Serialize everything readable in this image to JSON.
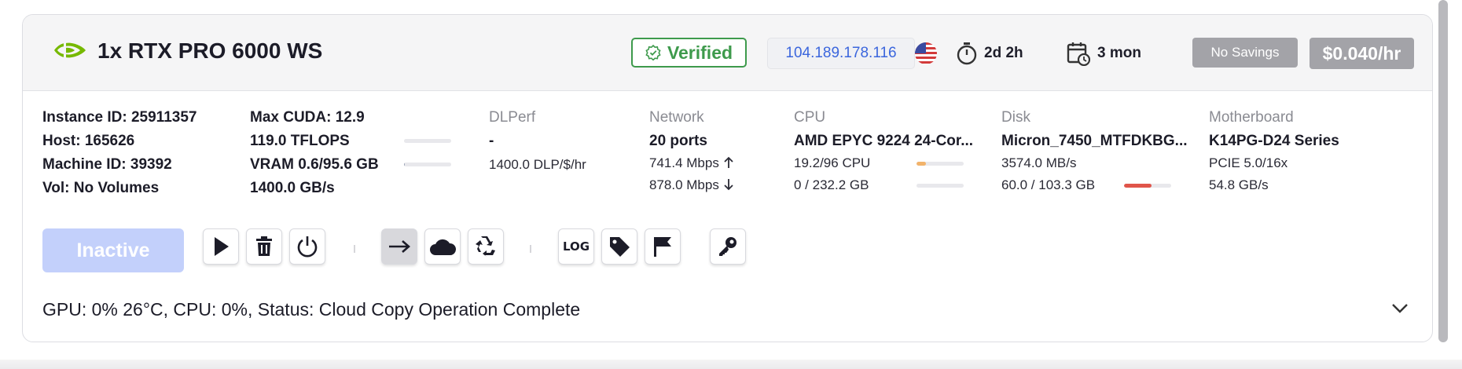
{
  "header": {
    "gpu_title": "1x RTX PRO 6000 WS",
    "verified_label": "Verified",
    "ip_address": "104.189.178.116",
    "uptime": "2d 2h",
    "duration": "3 mon",
    "savings_label": "No Savings",
    "price": "$0.040/hr"
  },
  "instance": {
    "instance_id": "Instance ID: 25911357",
    "host": "Host: 165626",
    "machine_id": "Machine ID: 39392",
    "vol": "Vol: No Volumes"
  },
  "gpu_stats": {
    "max_cuda": "Max CUDA: 12.9",
    "tflops": "119.0 TFLOPS",
    "vram": "VRAM 0.6/95.6 GB",
    "bandwidth": "1400.0 GB/s",
    "tflops_fraction": 0,
    "vram_fraction": 0.006
  },
  "dlperf": {
    "label": "DLPerf",
    "value": "-",
    "per_dollar": "1400.0 DLP/$/hr"
  },
  "network": {
    "label": "Network",
    "ports": "20 ports",
    "upload": "741.4 Mbps",
    "download": "878.0 Mbps"
  },
  "cpu": {
    "label": "CPU",
    "model": "AMD EPYC 9224 24-Cor...",
    "cores": "19.2/96 CPU",
    "ram": "0 / 232.2 GB",
    "cores_fraction": 0.2,
    "ram_fraction": 0
  },
  "disk": {
    "label": "Disk",
    "model": "Micron_7450_MTFDKBG...",
    "speed": "3574.0 MB/s",
    "usage": "60.0 / 103.3 GB",
    "usage_fraction": 0.58
  },
  "motherboard": {
    "label": "Motherboard",
    "model": "K14PG-D24 Series",
    "pcie": "PCIE 5.0/16x",
    "bandwidth": "54.8 GB/s"
  },
  "actions": {
    "inactive_label": "Inactive",
    "log_label": "LOG"
  },
  "status_line": "GPU: 0% 26°C, CPU: 0%, Status: Cloud Copy Operation Complete",
  "colors": {
    "verified": "#3e9a4c",
    "ip": "#3b66dd",
    "cpu_bar": "#f2b36b",
    "disk_bar": "#e0554a",
    "inactive_bg": "#c3d0fb"
  }
}
